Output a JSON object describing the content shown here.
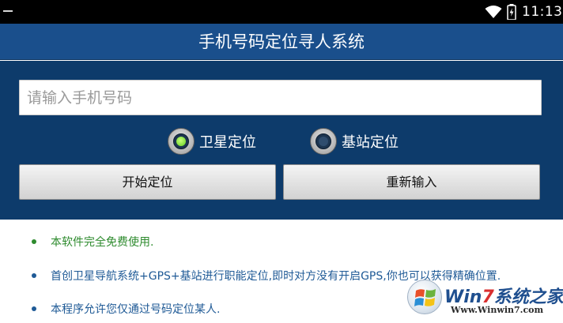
{
  "status_bar": {
    "time": "11:13",
    "icons": [
      "minus-icon",
      "wifi-icon",
      "battery-charging-icon"
    ]
  },
  "header": {
    "title": "手机号码定位寻人系统"
  },
  "form": {
    "phone_placeholder": "请输入手机号码",
    "phone_value": "",
    "location_modes": [
      {
        "label": "卫星定位",
        "checked": true
      },
      {
        "label": "基站定位",
        "checked": false
      }
    ],
    "start_button": "开始定位",
    "reset_button": "重新输入"
  },
  "notes": [
    {
      "text": "本软件完全免费使用.",
      "color": "#2e8b2e"
    },
    {
      "text": "首创卫星导航系统+GPS+基站进行职能定位,即时对方没有开启GPS,你也可以获得精确位置.",
      "color": "#1f5a96"
    },
    {
      "text": "本程序允许您仅通过号码定位某人.",
      "color": "#1f5a96"
    }
  ],
  "watermark": {
    "brand_prefix": "Win",
    "brand_seven": "7",
    "brand_suffix": "系统之家",
    "url": "Www.Winwin7.com"
  },
  "colors": {
    "title_bar": "#1a4f8c",
    "panel": "#0d3b6b",
    "status_bar": "#000000",
    "radio_checked": "#5fcf1f"
  }
}
